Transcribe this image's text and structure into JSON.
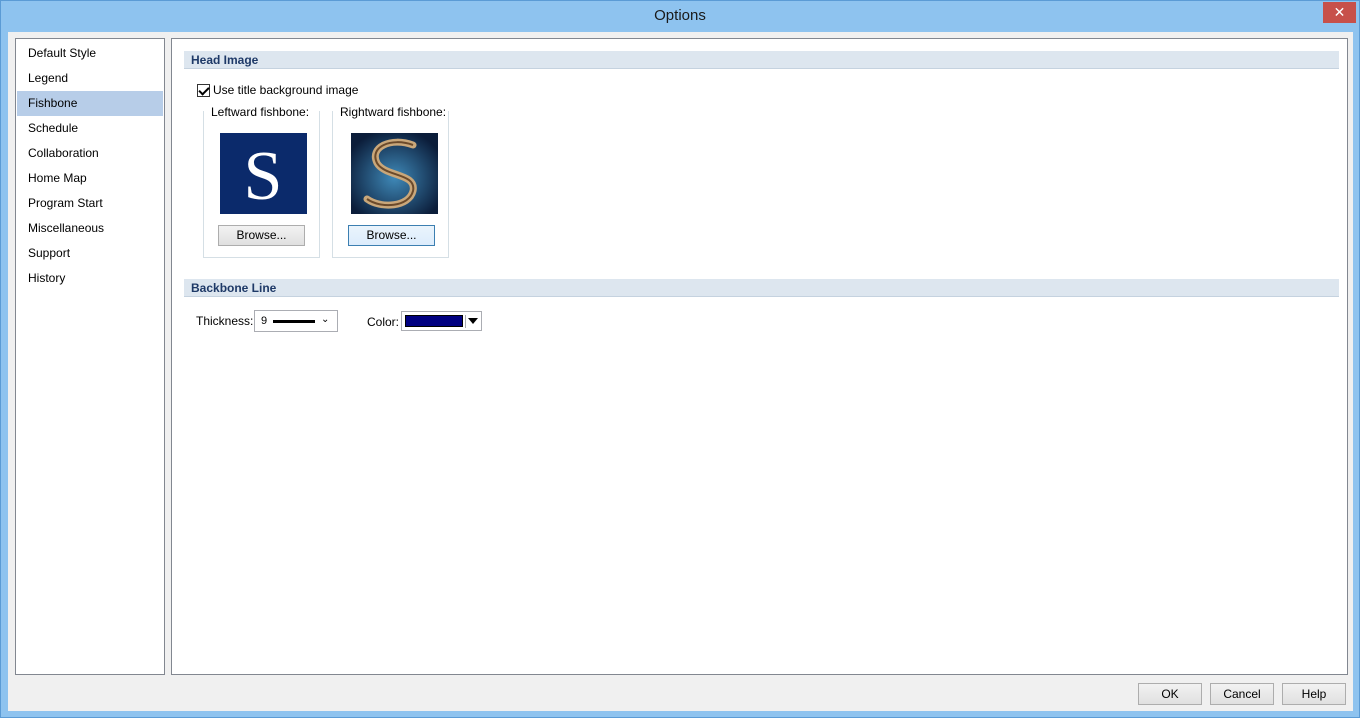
{
  "window": {
    "title": "Options",
    "close_glyph": "✕"
  },
  "sidebar": {
    "items": [
      {
        "label": "Default Style"
      },
      {
        "label": "Legend"
      },
      {
        "label": "Fishbone"
      },
      {
        "label": "Schedule"
      },
      {
        "label": "Collaboration"
      },
      {
        "label": "Home Map"
      },
      {
        "label": "Program Start"
      },
      {
        "label": "Miscellaneous"
      },
      {
        "label": "Support"
      },
      {
        "label": "History"
      }
    ],
    "selected": "Fishbone"
  },
  "head_image": {
    "section_title": "Head Image",
    "use_bg_label": "Use title background image",
    "use_bg_checked": true,
    "leftward": {
      "label": "Leftward fishbone:",
      "thumb_letter": "S",
      "browse_label": "Browse..."
    },
    "rightward": {
      "label": "Rightward fishbone:",
      "browse_label": "Browse..."
    }
  },
  "backbone": {
    "section_title": "Backbone Line",
    "thickness_label": "Thickness:",
    "thickness_value": "9",
    "color_label": "Color:",
    "color_value": "#000080"
  },
  "footer": {
    "ok": "OK",
    "cancel": "Cancel",
    "help": "Help"
  },
  "colors": {
    "selection": "#b7cde8",
    "section_header_bg": "#dde6ef",
    "section_header_text": "#1e3967",
    "titlebar": "#8ec3ef",
    "close_button": "#c7504a"
  }
}
